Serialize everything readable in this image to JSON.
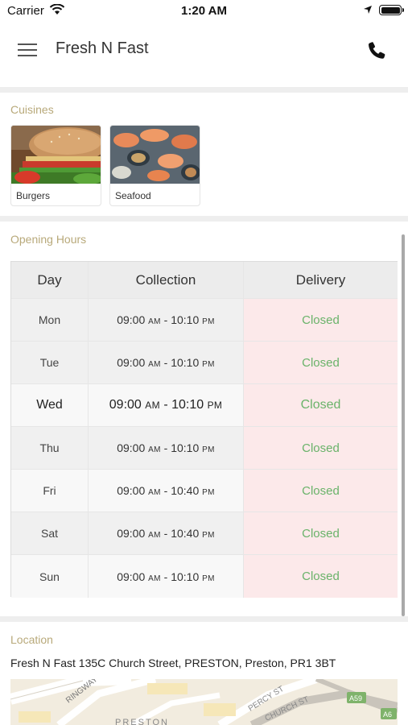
{
  "status_bar": {
    "carrier": "Carrier",
    "time": "1:20 AM"
  },
  "header": {
    "title": "Fresh N Fast",
    "menu_icon": "hamburger-menu-icon",
    "call_icon": "phone-icon"
  },
  "cuisines": {
    "title": "Cuisines",
    "items": [
      {
        "label": "Burgers"
      },
      {
        "label": "Seafood"
      }
    ]
  },
  "opening_hours": {
    "title": "Opening Hours",
    "columns": [
      "Day",
      "Collection",
      "Delivery"
    ],
    "rows": [
      {
        "day": "Mon",
        "open": "09:00",
        "open_ampm": "AM",
        "sep": " - ",
        "close": "10:10",
        "close_ampm": "PM",
        "delivery": "Closed"
      },
      {
        "day": "Tue",
        "open": "09:00",
        "open_ampm": "AM",
        "sep": " - ",
        "close": "10:10",
        "close_ampm": "PM",
        "delivery": "Closed"
      },
      {
        "day": "Wed",
        "open": "09:00",
        "open_ampm": "AM",
        "sep": " - ",
        "close": "10:10",
        "close_ampm": "PM",
        "delivery": "Closed"
      },
      {
        "day": "Thu",
        "open": "09:00",
        "open_ampm": "AM",
        "sep": " - ",
        "close": "10:10",
        "close_ampm": "PM",
        "delivery": "Closed"
      },
      {
        "day": "Fri",
        "open": "09:00",
        "open_ampm": "AM",
        "sep": " - ",
        "close": "10:40",
        "close_ampm": "PM",
        "delivery": "Closed"
      },
      {
        "day": "Sat",
        "open": "09:00",
        "open_ampm": "AM",
        "sep": " - ",
        "close": "10:40",
        "close_ampm": "PM",
        "delivery": "Closed"
      },
      {
        "day": "Sun",
        "open": "09:00",
        "open_ampm": "AM",
        "sep": " - ",
        "close": "10:10",
        "close_ampm": "PM",
        "delivery": "Closed"
      }
    ]
  },
  "location": {
    "title": "Location",
    "address": "Fresh N Fast 135C Church Street, PRESTON, Preston, PR1 3BT",
    "map_labels": [
      "RINGWAY",
      "PERCY ST",
      "CHURCH ST",
      "PRESTON",
      "A59",
      "A6"
    ]
  },
  "colors": {
    "section_title": "#b8a97a",
    "closed_text": "#6ab36a",
    "closed_bg": "#fce9ea",
    "divider": "#eeeeee"
  }
}
